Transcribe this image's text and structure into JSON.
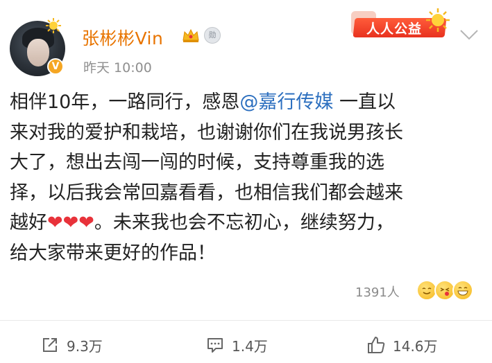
{
  "header": {
    "username": "张彬彬Vin",
    "timestamp": "昨天 10:00",
    "verified_badge": "V",
    "medal_badge": "勋",
    "charity_badge": "人人公益"
  },
  "post": {
    "lines": [
      [
        "相伴10年，一路同行，感恩",
        "@嘉行传媒",
        " 一直以"
      ],
      [
        "来对我的爱护和栽培，也谢谢你们在我说男孩长"
      ],
      [
        "大了，想出去闯一闯的时候，支持尊重我的选"
      ],
      [
        "择，以后我会常回嘉看看，也相信我们都会越来"
      ],
      [
        "越好",
        "❤❤❤",
        "。未来我也会不忘初心，继续努力，"
      ],
      [
        "给大家带来更好的作品！"
      ]
    ],
    "mention_color": "#2c6fbf"
  },
  "reactions": {
    "count": "1391人",
    "emojis": [
      "smile-face",
      "kiss-face",
      "grin-face"
    ]
  },
  "actions": {
    "repost": {
      "label": "9.3万",
      "icon": "share-icon"
    },
    "comment": {
      "label": "1.4万",
      "icon": "comment-icon"
    },
    "like": {
      "label": "14.6万",
      "icon": "thumbs-up-icon"
    }
  },
  "colors": {
    "username": "#e87400",
    "mention": "#2c6fbf",
    "heart": "#e8323a",
    "muted": "#8f8f8f"
  }
}
